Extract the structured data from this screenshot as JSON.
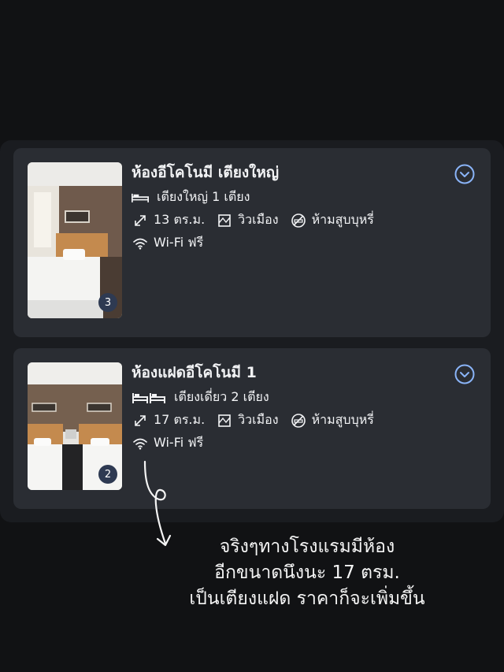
{
  "rooms": [
    {
      "name": "ห้องอีโคโนมี เตียงใหญ่",
      "bed": "เตียงใหญ่ 1 เตียง",
      "size": "13 ตร.ม.",
      "view": "วิวเมือง",
      "smoking": "ห้ามสูบบุหรี่",
      "wifi": "Wi-Fi ฟรี",
      "photo_count": "3",
      "bed_icon": "double-bed-icon",
      "accent": "#8ab4f8"
    },
    {
      "name": "ห้องแฝดอีโคโนมี 1",
      "bed": "เตียงเดี่ยว 2 เตียง",
      "size": "17 ตร.ม.",
      "view": "วิวเมือง",
      "smoking": "ห้ามสูบบุหรี่",
      "wifi": "Wi-Fi ฟรี",
      "photo_count": "2",
      "bed_icon": "twin-beds-icon",
      "accent": "#8ab4f8"
    }
  ],
  "annotation": {
    "line1": "จริงๆทางโรงแรมมีห้อง",
    "line2": "อีกขนาดนึงนะ 17 ตรม.",
    "line3": "เป็นเตียงแฝด ราคาก็จะเพิ่มขึ้น"
  }
}
